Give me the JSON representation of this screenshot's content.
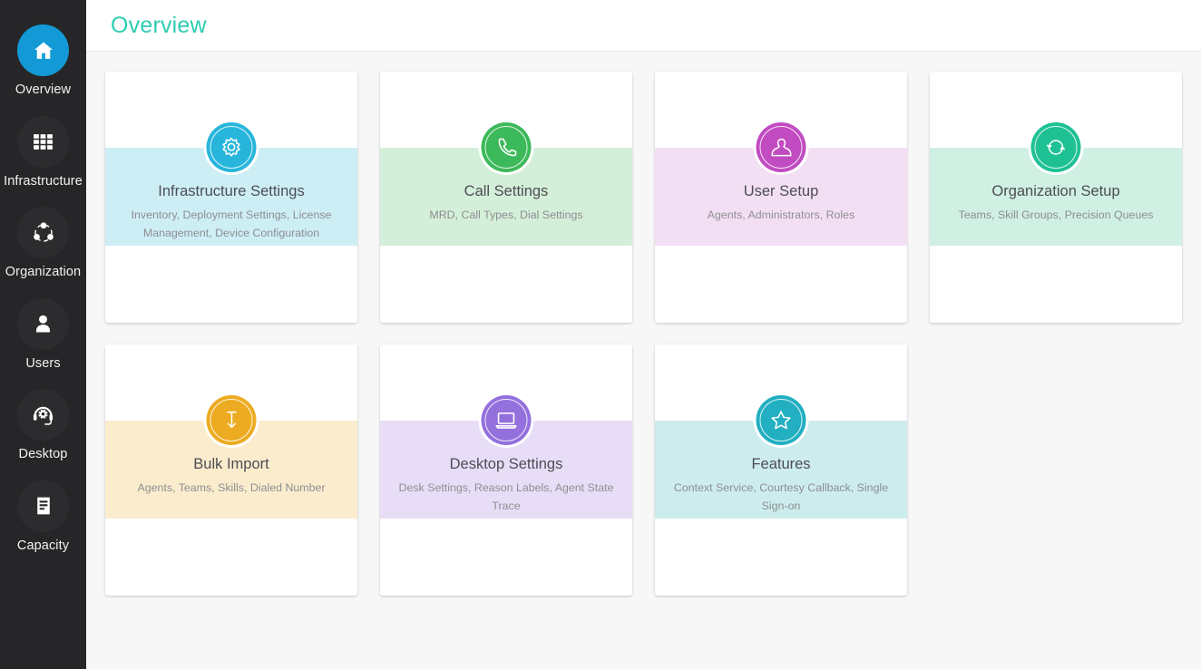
{
  "header": {
    "title": "Overview",
    "title_color": "#2ecdb2"
  },
  "sidebar": {
    "background": "#262628",
    "active_color": "#139ad6",
    "items": [
      {
        "label": "Overview",
        "icon": "home-icon",
        "active": true
      },
      {
        "label": "Infrastructure",
        "icon": "grid-icon",
        "active": false
      },
      {
        "label": "Organization",
        "icon": "share-nodes-icon",
        "active": false
      },
      {
        "label": "Users",
        "icon": "user-icon",
        "active": false
      },
      {
        "label": "Desktop",
        "icon": "headset-gear-icon",
        "active": false
      },
      {
        "label": "Capacity",
        "icon": "document-icon",
        "active": false
      }
    ]
  },
  "cards": [
    {
      "id": "infrastructure-settings",
      "title": "Infrastructure Settings",
      "subtitle": "Inventory, Deployment Settings, License Management, Device Configuration",
      "icon": "gear-icon",
      "icon_color": "#27b5db",
      "band_color": "#cdeef5"
    },
    {
      "id": "call-settings",
      "title": "Call Settings",
      "subtitle": "MRD, Call Types, Dial Settings",
      "icon": "phone-icon",
      "icon_color": "#3cb95a",
      "band_color": "#d4efd9"
    },
    {
      "id": "user-setup",
      "title": "User Setup",
      "subtitle": "Agents, Administrators, Roles",
      "icon": "user-outline-icon",
      "icon_color": "#c14bc1",
      "band_color": "#f3dff3"
    },
    {
      "id": "organization-setup",
      "title": "Organization Setup",
      "subtitle": "Teams, Skill Groups, Precision Queues",
      "icon": "circle-arrows-icon",
      "icon_color": "#1ec194",
      "band_color": "#cff0e2"
    },
    {
      "id": "bulk-import",
      "title": "Bulk Import",
      "subtitle": "Agents, Teams, Skills, Dialed Number",
      "icon": "download-arrow-icon",
      "icon_color": "#edab21",
      "band_color": "#fbeccd"
    },
    {
      "id": "desktop-settings",
      "title": "Desktop Settings",
      "subtitle": "Desk Settings, Reason Labels, Agent State Trace",
      "icon": "laptop-icon",
      "icon_color": "#9470dd",
      "band_color": "#e8ddf6"
    },
    {
      "id": "features",
      "title": "Features",
      "subtitle": "Context Service, Courtesy Callback, Single Sign-on",
      "icon": "star-icon",
      "icon_color": "#21afc1",
      "band_color": "#cdeced"
    }
  ]
}
